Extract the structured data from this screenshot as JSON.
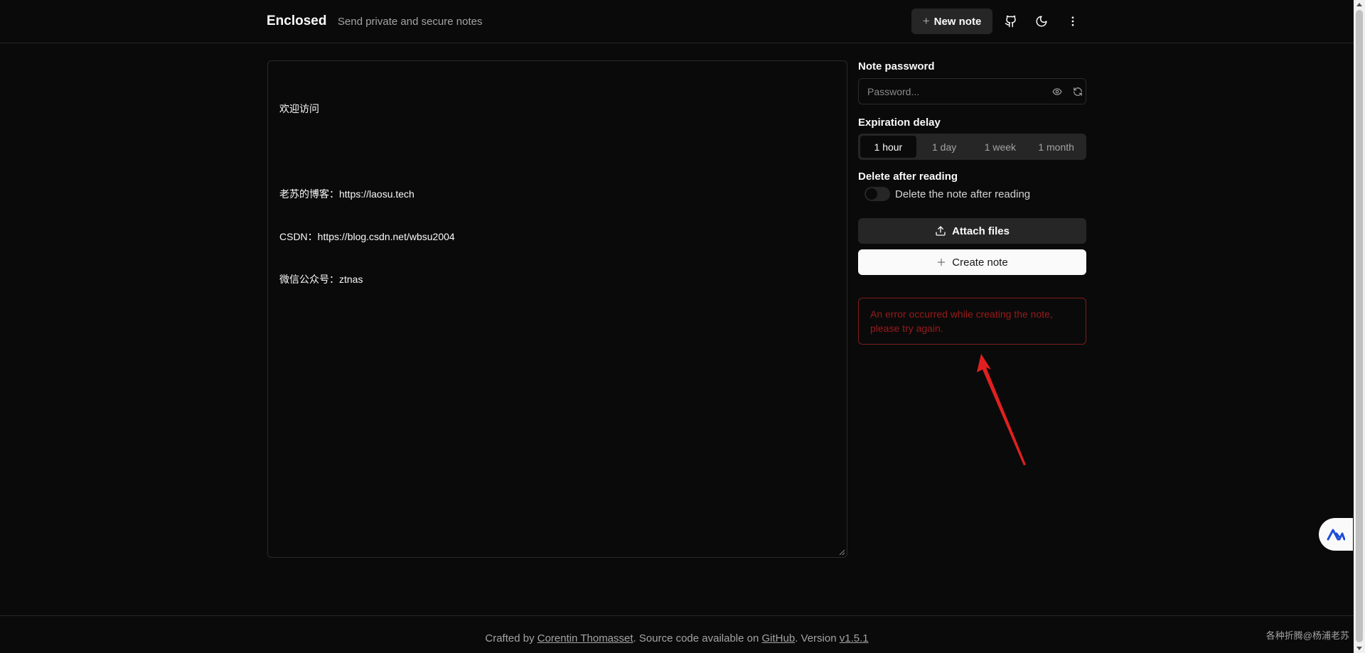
{
  "header": {
    "brand": "Enclosed",
    "tagline": "Send private and secure notes",
    "new_note_label": "New note",
    "icons": [
      "github-icon",
      "moon-icon",
      "more-vertical-icon"
    ]
  },
  "editor": {
    "lines": [
      "欢迎访问",
      "",
      "老苏的博客：https://laosu.tech",
      "CSDN：https://blog.csdn.net/wbsu2004",
      "微信公众号：ztnas"
    ]
  },
  "sidebar": {
    "password_label": "Note password",
    "password_placeholder": "Password...",
    "expiration_label": "Expiration delay",
    "expiration_options": [
      "1 hour",
      "1 day",
      "1 week",
      "1 month"
    ],
    "expiration_selected": "1 hour",
    "delete_label": "Delete after reading",
    "delete_toggle_text": "Delete the note after reading",
    "delete_toggle_on": false,
    "attach_label": "Attach files",
    "create_label": "Create note",
    "error_message": "An error occurred while creating the note, please try again."
  },
  "footer": {
    "prefix": "Crafted by ",
    "author": "Corentin Thomasset",
    "middle": ". Source code available on ",
    "github": "GitHub",
    "version_prefix": ". Version ",
    "version": "v1.5.1"
  },
  "watermark": "各种折腾@杨浦老苏",
  "colors": {
    "background": "#0a0a0a",
    "surface": "#262626",
    "error": "#991b1b",
    "annotation_arrow": "#e02020"
  }
}
